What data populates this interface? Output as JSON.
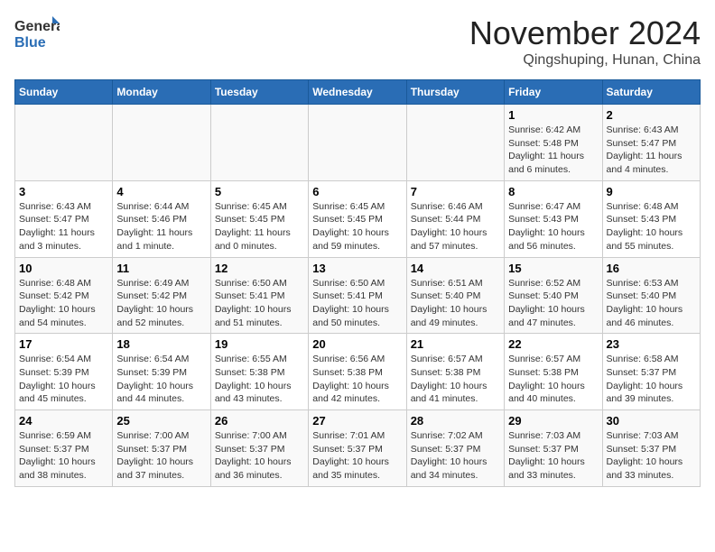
{
  "header": {
    "logo_general": "General",
    "logo_blue": "Blue",
    "main_title": "November 2024",
    "subtitle": "Qingshuping, Hunan, China"
  },
  "calendar": {
    "days_of_week": [
      "Sunday",
      "Monday",
      "Tuesday",
      "Wednesday",
      "Thursday",
      "Friday",
      "Saturday"
    ],
    "weeks": [
      [
        {
          "day": "",
          "info": ""
        },
        {
          "day": "",
          "info": ""
        },
        {
          "day": "",
          "info": ""
        },
        {
          "day": "",
          "info": ""
        },
        {
          "day": "",
          "info": ""
        },
        {
          "day": "1",
          "info": "Sunrise: 6:42 AM\nSunset: 5:48 PM\nDaylight: 11 hours and 6 minutes."
        },
        {
          "day": "2",
          "info": "Sunrise: 6:43 AM\nSunset: 5:47 PM\nDaylight: 11 hours and 4 minutes."
        }
      ],
      [
        {
          "day": "3",
          "info": "Sunrise: 6:43 AM\nSunset: 5:47 PM\nDaylight: 11 hours and 3 minutes."
        },
        {
          "day": "4",
          "info": "Sunrise: 6:44 AM\nSunset: 5:46 PM\nDaylight: 11 hours and 1 minute."
        },
        {
          "day": "5",
          "info": "Sunrise: 6:45 AM\nSunset: 5:45 PM\nDaylight: 11 hours and 0 minutes."
        },
        {
          "day": "6",
          "info": "Sunrise: 6:45 AM\nSunset: 5:45 PM\nDaylight: 10 hours and 59 minutes."
        },
        {
          "day": "7",
          "info": "Sunrise: 6:46 AM\nSunset: 5:44 PM\nDaylight: 10 hours and 57 minutes."
        },
        {
          "day": "8",
          "info": "Sunrise: 6:47 AM\nSunset: 5:43 PM\nDaylight: 10 hours and 56 minutes."
        },
        {
          "day": "9",
          "info": "Sunrise: 6:48 AM\nSunset: 5:43 PM\nDaylight: 10 hours and 55 minutes."
        }
      ],
      [
        {
          "day": "10",
          "info": "Sunrise: 6:48 AM\nSunset: 5:42 PM\nDaylight: 10 hours and 54 minutes."
        },
        {
          "day": "11",
          "info": "Sunrise: 6:49 AM\nSunset: 5:42 PM\nDaylight: 10 hours and 52 minutes."
        },
        {
          "day": "12",
          "info": "Sunrise: 6:50 AM\nSunset: 5:41 PM\nDaylight: 10 hours and 51 minutes."
        },
        {
          "day": "13",
          "info": "Sunrise: 6:50 AM\nSunset: 5:41 PM\nDaylight: 10 hours and 50 minutes."
        },
        {
          "day": "14",
          "info": "Sunrise: 6:51 AM\nSunset: 5:40 PM\nDaylight: 10 hours and 49 minutes."
        },
        {
          "day": "15",
          "info": "Sunrise: 6:52 AM\nSunset: 5:40 PM\nDaylight: 10 hours and 47 minutes."
        },
        {
          "day": "16",
          "info": "Sunrise: 6:53 AM\nSunset: 5:40 PM\nDaylight: 10 hours and 46 minutes."
        }
      ],
      [
        {
          "day": "17",
          "info": "Sunrise: 6:54 AM\nSunset: 5:39 PM\nDaylight: 10 hours and 45 minutes."
        },
        {
          "day": "18",
          "info": "Sunrise: 6:54 AM\nSunset: 5:39 PM\nDaylight: 10 hours and 44 minutes."
        },
        {
          "day": "19",
          "info": "Sunrise: 6:55 AM\nSunset: 5:38 PM\nDaylight: 10 hours and 43 minutes."
        },
        {
          "day": "20",
          "info": "Sunrise: 6:56 AM\nSunset: 5:38 PM\nDaylight: 10 hours and 42 minutes."
        },
        {
          "day": "21",
          "info": "Sunrise: 6:57 AM\nSunset: 5:38 PM\nDaylight: 10 hours and 41 minutes."
        },
        {
          "day": "22",
          "info": "Sunrise: 6:57 AM\nSunset: 5:38 PM\nDaylight: 10 hours and 40 minutes."
        },
        {
          "day": "23",
          "info": "Sunrise: 6:58 AM\nSunset: 5:37 PM\nDaylight: 10 hours and 39 minutes."
        }
      ],
      [
        {
          "day": "24",
          "info": "Sunrise: 6:59 AM\nSunset: 5:37 PM\nDaylight: 10 hours and 38 minutes."
        },
        {
          "day": "25",
          "info": "Sunrise: 7:00 AM\nSunset: 5:37 PM\nDaylight: 10 hours and 37 minutes."
        },
        {
          "day": "26",
          "info": "Sunrise: 7:00 AM\nSunset: 5:37 PM\nDaylight: 10 hours and 36 minutes."
        },
        {
          "day": "27",
          "info": "Sunrise: 7:01 AM\nSunset: 5:37 PM\nDaylight: 10 hours and 35 minutes."
        },
        {
          "day": "28",
          "info": "Sunrise: 7:02 AM\nSunset: 5:37 PM\nDaylight: 10 hours and 34 minutes."
        },
        {
          "day": "29",
          "info": "Sunrise: 7:03 AM\nSunset: 5:37 PM\nDaylight: 10 hours and 33 minutes."
        },
        {
          "day": "30",
          "info": "Sunrise: 7:03 AM\nSunset: 5:37 PM\nDaylight: 10 hours and 33 minutes."
        }
      ]
    ]
  }
}
